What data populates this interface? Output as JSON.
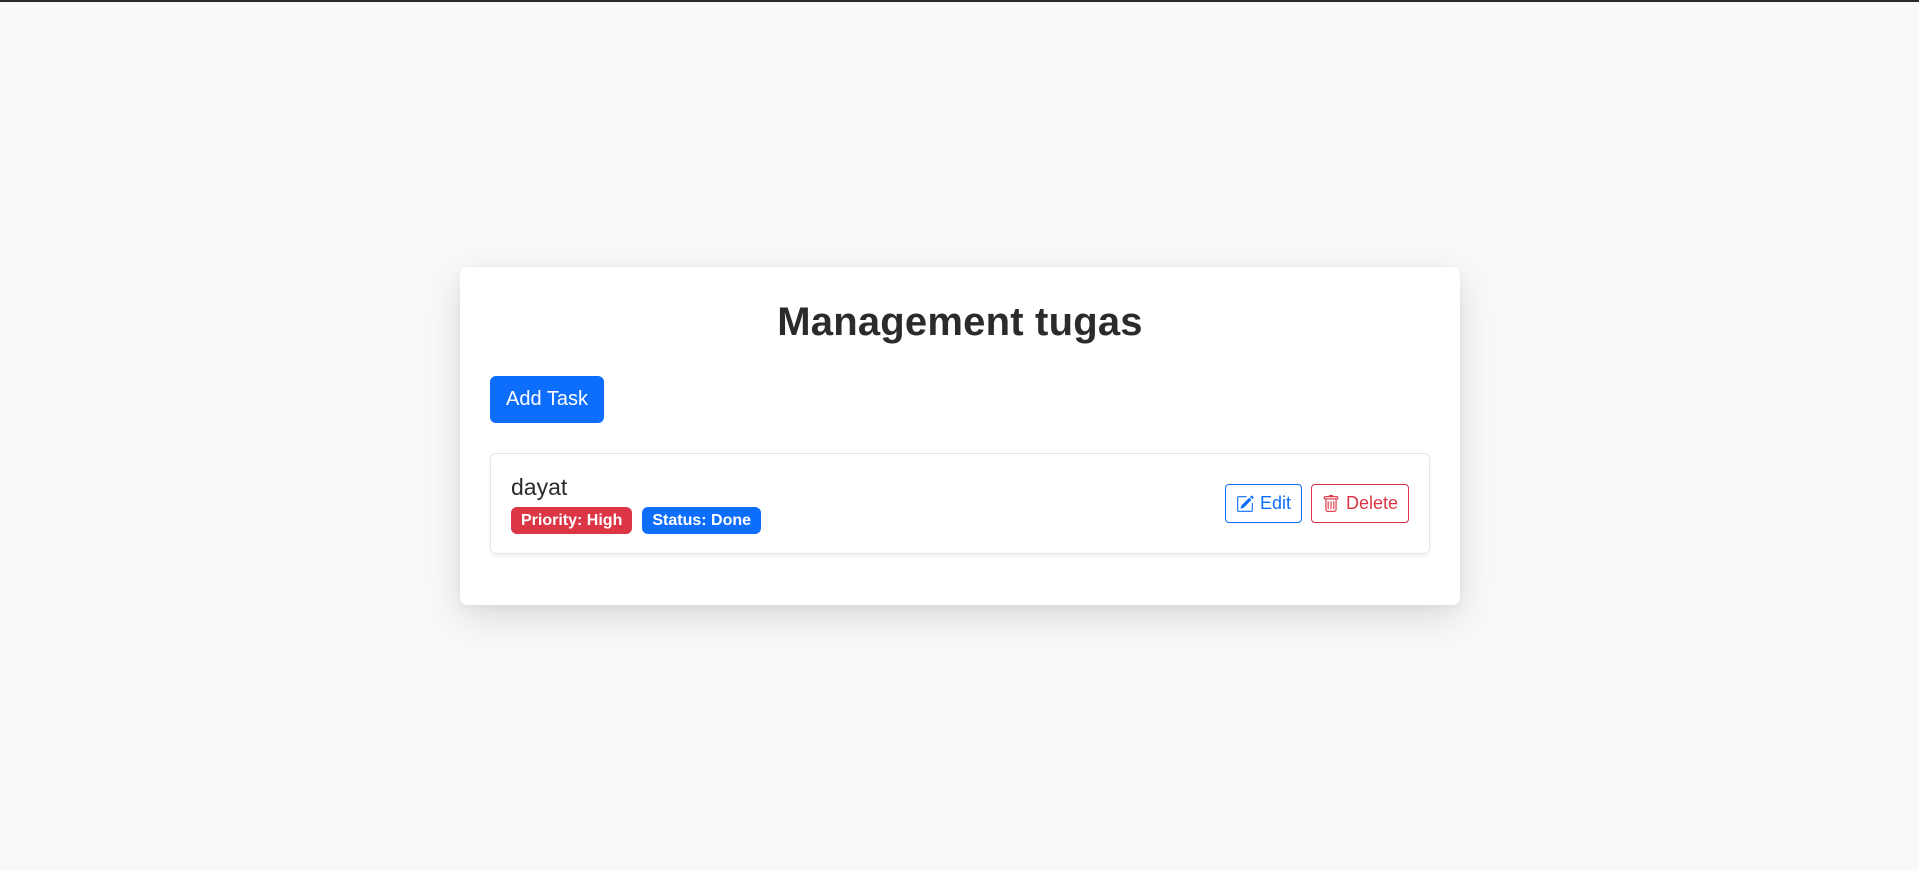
{
  "page": {
    "title": "Management tugas",
    "add_button_label": "Add Task"
  },
  "tasks": [
    {
      "title": "dayat",
      "priority_badge": "Priority: High",
      "status_badge": "Status: Done",
      "edit_label": "Edit",
      "delete_label": "Delete"
    }
  ],
  "icons": {
    "edit": "edit-icon",
    "delete": "trash-icon"
  },
  "colors": {
    "primary": "#0d6efd",
    "danger": "#dc3545",
    "background": "#f8f9fa",
    "card": "#ffffff",
    "heading": "#2b2b2b"
  }
}
